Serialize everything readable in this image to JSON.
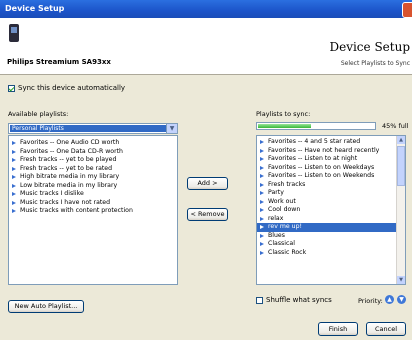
{
  "window": {
    "title": "Device Setup"
  },
  "header": {
    "device_name": "Philips Streamium SA93xx",
    "title": "Device Setup",
    "subtitle": "Select Playlists to Sync"
  },
  "sync_auto": {
    "label": "Sync this device automatically",
    "checked": true
  },
  "available": {
    "label": "Available playlists:",
    "combo_value": "Personal Playlists",
    "items": [
      "Favorites -- One Audio CD worth",
      "Favorites -- One Data CD-R worth",
      "Fresh tracks -- yet to be played",
      "Fresh tracks -- yet to be rated",
      "High bitrate media in my library",
      "Low bitrate media in my library",
      "Music tracks I dislike",
      "Music tracks I have not rated",
      "Music tracks with content protection"
    ]
  },
  "buttons": {
    "add": "Add  >",
    "remove": "<  Remove",
    "new_auto": "New Auto Playlist...",
    "finish": "Finish",
    "cancel": "Cancel"
  },
  "sync": {
    "label": "Playlists to sync:",
    "capacity_text": "45% full",
    "capacity_fraction": 0.45,
    "items": [
      "Favorites -- 4 and 5 star rated",
      "Favorites -- Have not heard recently",
      "Favorites -- Listen to at night",
      "Favorites -- Listen to on Weekdays",
      "Favorites -- Listen to on Weekends",
      "Fresh tracks",
      "Party",
      "Work out",
      "Cool down",
      "relax",
      "rev me up!",
      "Blues",
      "Classical",
      "Classic Rock"
    ],
    "selected_index": 10
  },
  "shuffle": {
    "label": "Shuffle what syncs",
    "checked": false
  },
  "priority": {
    "label": "Priority:"
  },
  "colors": {
    "accent": "#316ac5",
    "titlebar": "#1c54c9",
    "progress": "#37b737"
  }
}
